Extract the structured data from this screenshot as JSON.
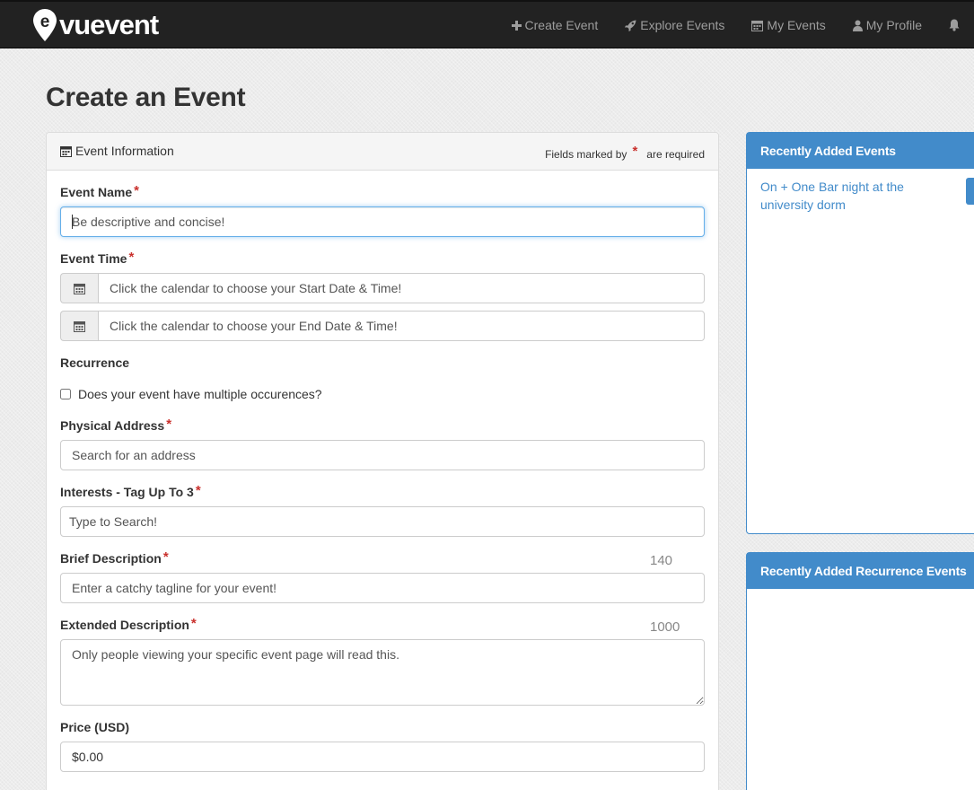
{
  "navbar": {
    "brand": "vuevent",
    "items": [
      {
        "label": "Create Event",
        "icon": "plus-icon"
      },
      {
        "label": "Explore Events",
        "icon": "rocket-icon"
      },
      {
        "label": "My Events",
        "icon": "calendar-icon"
      },
      {
        "label": "My Profile",
        "icon": "user-icon"
      }
    ],
    "bell_icon": "bell-icon"
  },
  "page": {
    "title": "Create an Event"
  },
  "form": {
    "heading": "Event Information",
    "required_note_prefix": "Fields marked by",
    "required_note_suffix": "are required",
    "required_marker": "*",
    "event_name": {
      "label": "Event Name",
      "placeholder": "Be descriptive and concise!"
    },
    "event_time": {
      "label": "Event Time",
      "start_placeholder": "Click the calendar to choose your Start Date & Time!",
      "end_placeholder": "Click the calendar to choose your End Date & Time!"
    },
    "recurrence": {
      "label": "Recurrence",
      "checkbox_label": "Does your event have multiple occurences?"
    },
    "address": {
      "label": "Physical Address",
      "placeholder": "Search for an address"
    },
    "interests": {
      "label": "Interests - Tag Up To 3",
      "placeholder": "Type to Search!"
    },
    "brief": {
      "label": "Brief Description",
      "counter": "140",
      "placeholder": "Enter a catchy tagline for your event!"
    },
    "extended": {
      "label": "Extended Description",
      "counter": "1000",
      "placeholder": "Only people viewing your specific event page will read this."
    },
    "price": {
      "label": "Price (USD)",
      "value": "$0.00"
    }
  },
  "sidebar": {
    "recent_heading": "Recently Added Events",
    "recent_items": [
      "On + One Bar night at the university dorm"
    ],
    "recurrence_heading": "Recently Added Recurrence Events"
  },
  "colors": {
    "navbar_bg": "#222222",
    "accent": "#428bca",
    "required_star": "#c9302c"
  }
}
